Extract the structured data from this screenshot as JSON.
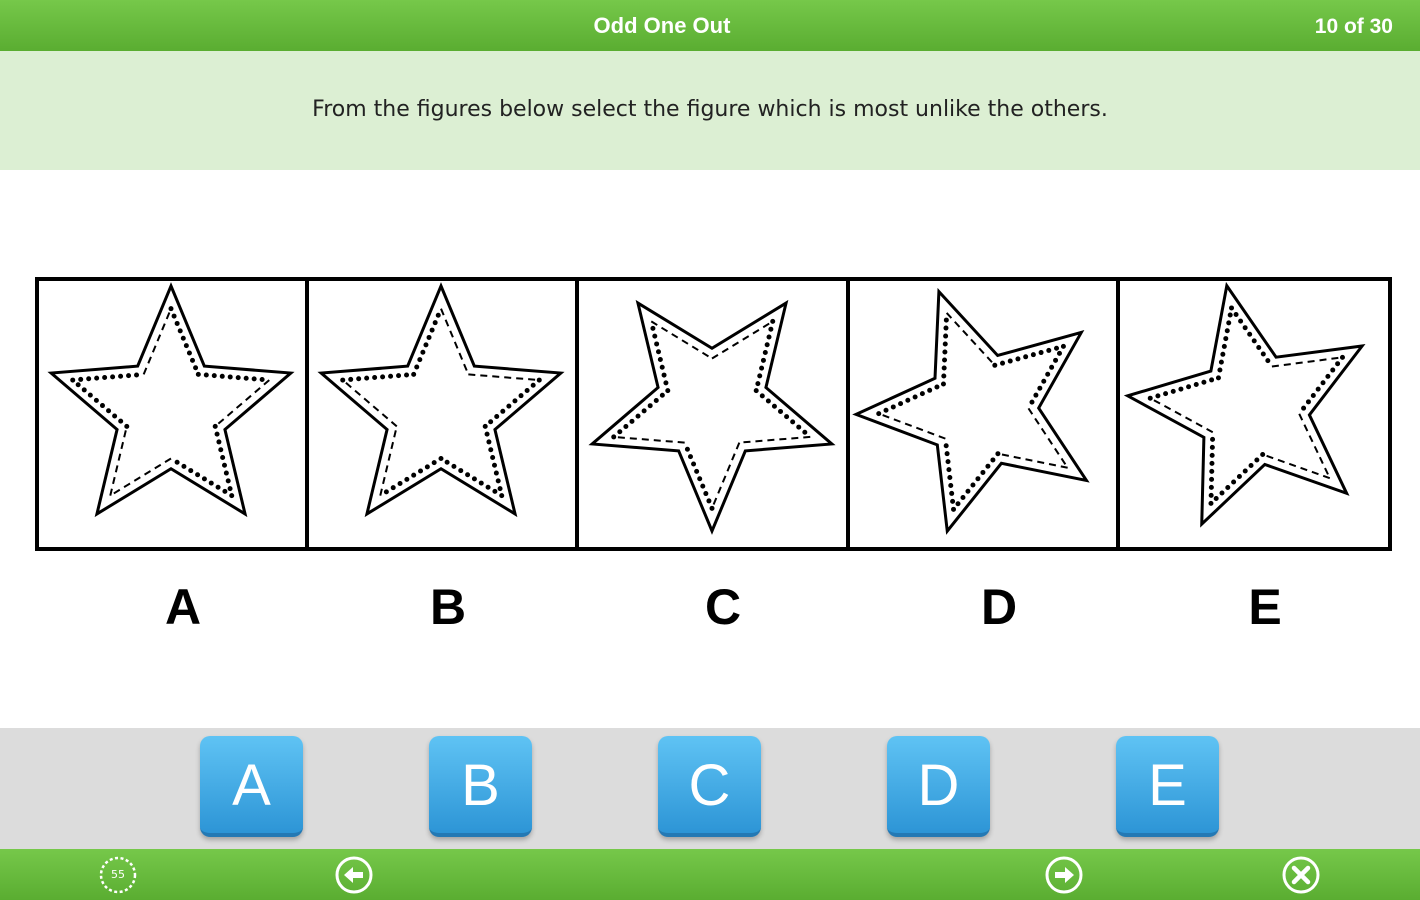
{
  "header": {
    "title": "Odd One Out",
    "progress": "10 of 30"
  },
  "question": {
    "text": "From the figures below select the figure which is most unlike the others."
  },
  "figures": [
    {
      "label": "A"
    },
    {
      "label": "B"
    },
    {
      "label": "C"
    },
    {
      "label": "D"
    },
    {
      "label": "E"
    }
  ],
  "answers": [
    {
      "label": "A"
    },
    {
      "label": "B"
    },
    {
      "label": "C"
    },
    {
      "label": "D"
    },
    {
      "label": "E"
    }
  ],
  "footer": {
    "timer_value": "55",
    "icons": [
      "timer-icon",
      "back-arrow-icon",
      "forward-arrow-icon",
      "close-icon"
    ]
  },
  "colors": {
    "header_green": "#5aad31",
    "question_band": "#dcefd3",
    "answer_button": "#3aa7e6",
    "answer_bar": "#dcdcdc"
  }
}
